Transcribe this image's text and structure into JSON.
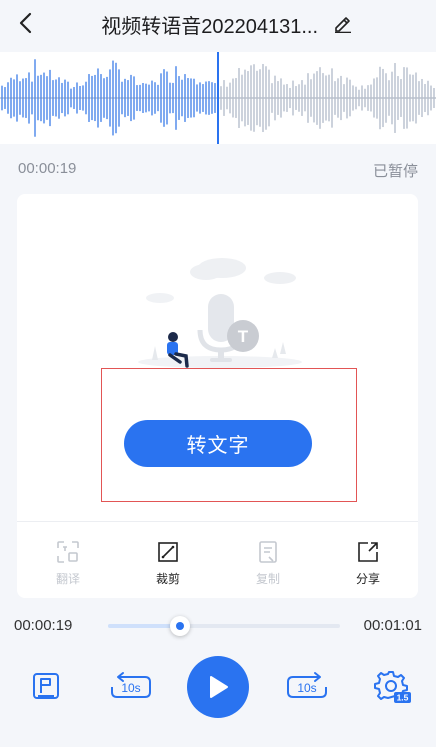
{
  "header": {
    "title": "视频转语音202204131..."
  },
  "player": {
    "current_time_top": "00:00:19",
    "status": "已暂停",
    "progress_current": "00:00:19",
    "progress_total": "00:01:01",
    "progress_fraction": 0.31
  },
  "main": {
    "convert_button_label": "转文字"
  },
  "toolbar": {
    "items": [
      {
        "label": "翻译",
        "icon": "translate-icon",
        "enabled": false
      },
      {
        "label": "裁剪",
        "icon": "crop-icon",
        "enabled": true
      },
      {
        "label": "复制",
        "icon": "copy-icon",
        "enabled": false
      },
      {
        "label": "分享",
        "icon": "share-icon",
        "enabled": true
      }
    ]
  },
  "controls": {
    "rewind_label": "10s",
    "forward_label": "10s",
    "speed_badge": "1.5"
  },
  "colors": {
    "accent": "#2a73f0",
    "highlight_box": "#e25555",
    "wave_played": "#4a86ea",
    "wave_unplayed": "#b7bfcc"
  }
}
